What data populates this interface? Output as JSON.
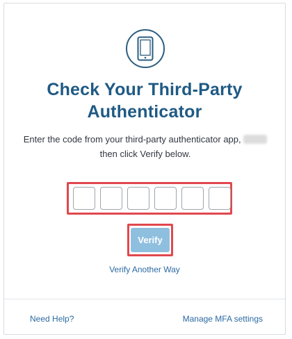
{
  "icon": "mobile-phone-icon",
  "colors": {
    "title": "#1f5a84",
    "link": "#2b6aa2",
    "verify_button": "#8fbfdf",
    "highlight": "#e0484e"
  },
  "title_line1": "Check Your Third-Party",
  "title_line2": "Authenticator",
  "instructions_part1": "Enter the code from your third-party authenticator app,",
  "instructions_part2": "then click Verify below.",
  "code_inputs": [
    "",
    "",
    "",
    "",
    "",
    ""
  ],
  "verify_label": "Verify",
  "verify_another_way": "Verify Another Way",
  "footer": {
    "need_help": "Need Help?",
    "manage_mfa": "Manage MFA settings"
  }
}
